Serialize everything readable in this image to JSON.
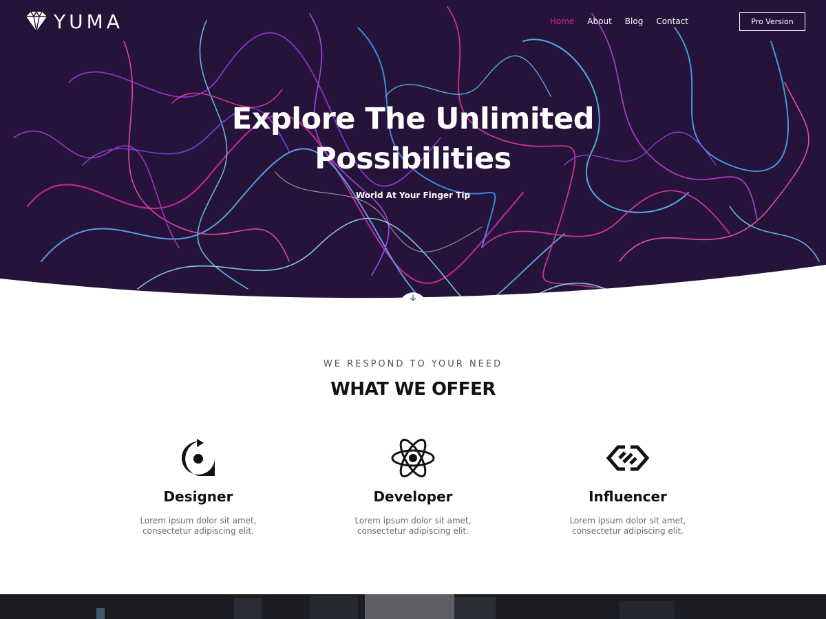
{
  "brand": {
    "name": "YUMA"
  },
  "nav": {
    "items": [
      {
        "label": "Home",
        "active": true
      },
      {
        "label": "About",
        "active": false
      },
      {
        "label": "Blog",
        "active": false
      },
      {
        "label": "Contact",
        "active": false
      }
    ],
    "cta_label": "Pro Version"
  },
  "hero": {
    "title": "Explore The Unlimited Possibilities",
    "subtitle": "World At Your Finger Tip"
  },
  "offer": {
    "eyebrow": "WE RESPOND TO YOUR NEED",
    "title": "WHAT WE OFFER",
    "cards": [
      {
        "icon": "refresh-pin-icon",
        "title": "Designer",
        "text": "Lorem ipsum dolor sit amet, consectetur adipiscing elit."
      },
      {
        "icon": "atom-icon",
        "title": "Developer",
        "text": "Lorem ipsum dolor sit amet, consectetur adipiscing elit."
      },
      {
        "icon": "link-icon",
        "title": "Influencer",
        "text": "Lorem ipsum dolor sit amet, consectetur adipiscing elit."
      }
    ]
  },
  "colors": {
    "hero_bg": "#26133a",
    "accent": "#d9238f",
    "text_dark": "#111111",
    "text_muted": "#6b6b6b"
  }
}
